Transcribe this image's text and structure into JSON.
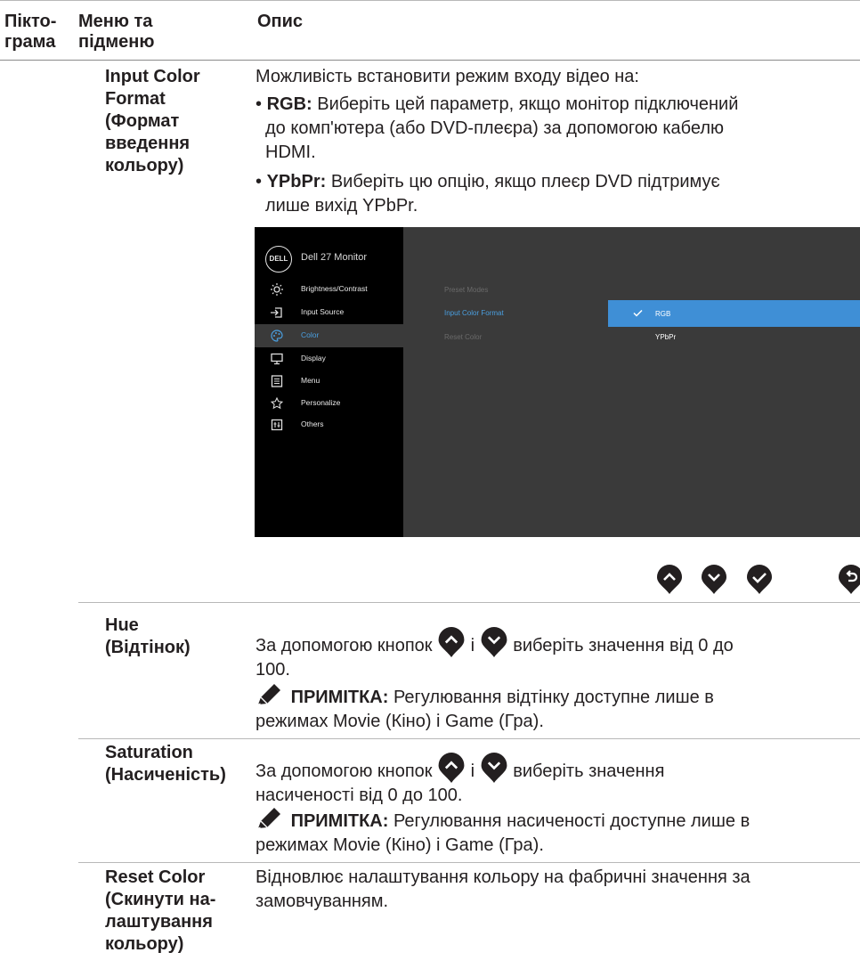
{
  "header": {
    "col1": [
      "Пікто-",
      "грама"
    ],
    "col2": [
      "Меню та",
      "підменю"
    ],
    "col3": "Опис"
  },
  "input_color_format": {
    "title": [
      "Input Color",
      "Format",
      "(Формат",
      "введення",
      "кольору)"
    ],
    "intro": "Можливість встановити режим входу відео на:",
    "rgb_term": "RGB:",
    "rgb_lines": [
      " Виберіть цей параметр, якщо монітор підключений",
      "до комп'ютера (або DVD-плеєра) за допомогою кабелю",
      "HDMI."
    ],
    "ypbpr_term": "YPbPr:",
    "ypbpr_lines": [
      " Виберіть цю опцію, якщо плеєр DVD підтримує",
      "лише вихід YPbPr."
    ],
    "bullet": "•"
  },
  "osd": {
    "logo": "DELL",
    "model": "Dell 27 Monitor",
    "menu": [
      {
        "label": "Brightness/Contrast",
        "icon": "brightness-icon"
      },
      {
        "label": "Input Source",
        "icon": "input-source-icon"
      },
      {
        "label": "Color",
        "icon": "palette-icon",
        "selected": true
      },
      {
        "label": "Display",
        "icon": "display-icon"
      },
      {
        "label": "Menu",
        "icon": "menu-icon"
      },
      {
        "label": "Personalize",
        "icon": "star-icon"
      },
      {
        "label": "Others",
        "icon": "others-icon"
      }
    ],
    "submenu": [
      "Preset Modes",
      "Input Color Format",
      "Reset Color"
    ],
    "options": [
      "RGB",
      "YPbPr"
    ],
    "selected_option": "RGB",
    "highlight_color": "#3f8fd6",
    "buttons": [
      "up-arrow-icon",
      "down-arrow-icon",
      "check-icon",
      "back-icon"
    ]
  },
  "hue": {
    "title": [
      "Hue",
      "(Відтінок)"
    ],
    "text1_a": "За допомогою кнопок ",
    "text1_mid": " і ",
    "text1_b": " виберіть значення від 0 до",
    "text1_line2": "100.",
    "note_label": "ПРИМІТКА:",
    "note_text": " Регулювання відтінку доступне лише в",
    "note_line2": "режимах Movie (Кіно) і Game (Гра)."
  },
  "saturation": {
    "title": [
      "Saturation",
      "(Насиченість)"
    ],
    "text1_a": "За допомогою кнопок ",
    "text1_mid": " і ",
    "text1_b": " виберіть значення",
    "text1_line2": "насиченості від 0 до 100.",
    "note_label": "ПРИМІТКА:",
    "note_text": " Регулювання насиченості доступне лише в",
    "note_line2": "режимах Movie (Кіно) і Game (Гра)."
  },
  "reset_color": {
    "title": [
      "Reset Color",
      "(Скинути на-",
      "лаштування",
      "кольору)"
    ],
    "lines": [
      "Відновлює налаштування кольору на фабричні значення за",
      "замовчуванням."
    ]
  }
}
